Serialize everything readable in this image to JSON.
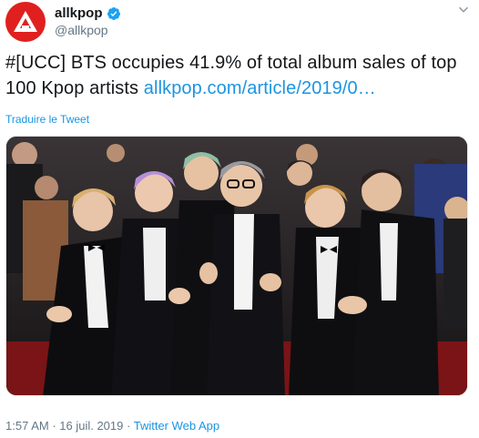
{
  "user": {
    "display_name": "allkpop",
    "handle": "@allkpop",
    "verified": true,
    "avatar_color": "#e0201f",
    "avatar_icon": "allkpop-logo-icon"
  },
  "tweet": {
    "text_main": "#[UCC] BTS occupies 41.9% of total album sales of top 100 Kpop artists ",
    "link_text": "allkpop.com/article/2019/0…",
    "translate_label": "Traduire le Tweet"
  },
  "media": {
    "photo_icon": "group-photo-icon"
  },
  "meta": {
    "time": "1:57 AM",
    "separator": " · ",
    "date": "16 juil. 2019",
    "app": "Twitter Web App"
  },
  "colors": {
    "link": "#1b95e0",
    "secondary_text": "#657786",
    "verified_badge": "#1da1f2"
  }
}
